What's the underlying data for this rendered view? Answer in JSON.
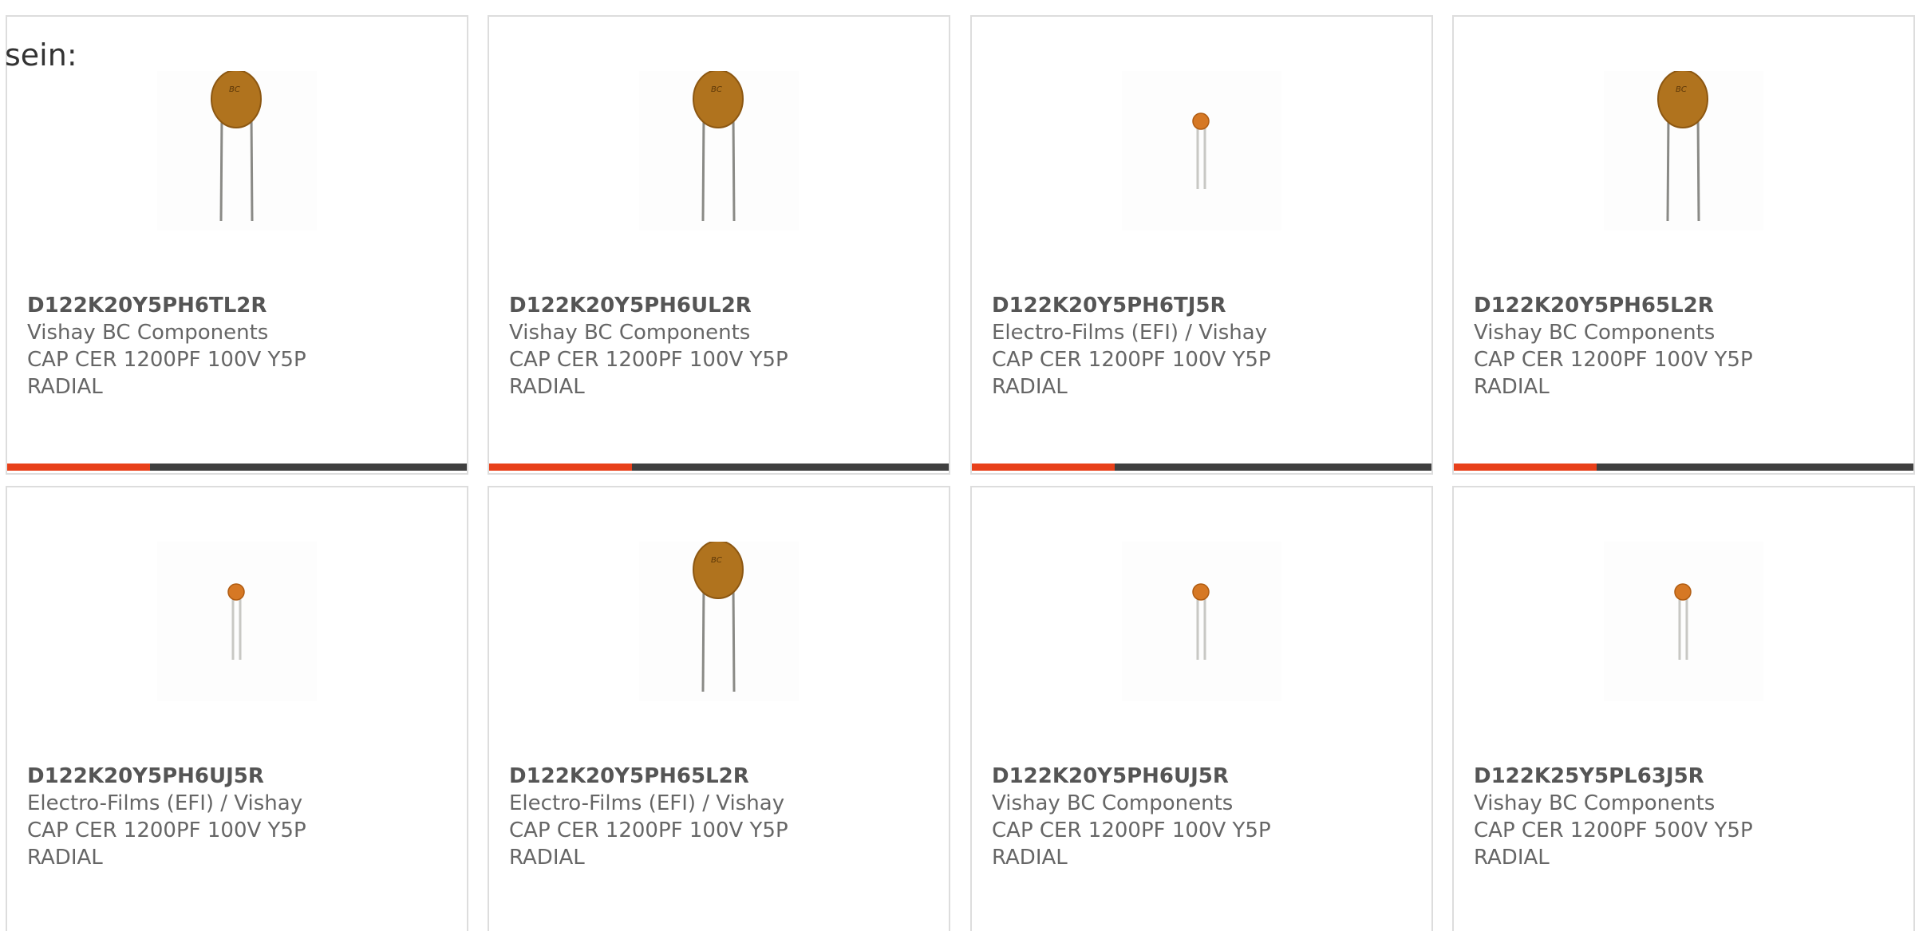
{
  "intro_text": "sein:",
  "colors": {
    "accent": "#e8401a",
    "track": "#3f3f3f",
    "body_large": "#b0731e",
    "body_small": "#d67824"
  },
  "products": [
    {
      "part": "D122K20Y5PH6TL2R",
      "maker": "Vishay BC Components",
      "desc": "CAP CER 1200PF 100V Y5P",
      "desc2": "RADIAL",
      "image": "large-disc-capacitor",
      "progress": 0.31
    },
    {
      "part": "D122K20Y5PH6UL2R",
      "maker": "Vishay BC Components",
      "desc": "CAP CER 1200PF 100V Y5P",
      "desc2": "RADIAL",
      "image": "large-disc-capacitor",
      "progress": 0.31
    },
    {
      "part": "D122K20Y5PH6TJ5R",
      "maker": "Electro-Films (EFI) / Vishay",
      "desc": "CAP CER 1200PF 100V Y5P",
      "desc2": "RADIAL",
      "image": "small-disc-capacitor",
      "progress": 0.31
    },
    {
      "part": "D122K20Y5PH65L2R",
      "maker": "Vishay BC Components",
      "desc": "CAP CER 1200PF 100V Y5P",
      "desc2": "RADIAL",
      "image": "large-disc-capacitor",
      "progress": 0.31
    },
    {
      "part": "D122K20Y5PH6UJ5R",
      "maker": "Electro-Films (EFI) / Vishay",
      "desc": "CAP CER 1200PF 100V Y5P",
      "desc2": "RADIAL",
      "image": "small-disc-capacitor"
    },
    {
      "part": "D122K20Y5PH65L2R",
      "maker": "Electro-Films (EFI) / Vishay",
      "desc": "CAP CER 1200PF 100V Y5P",
      "desc2": "RADIAL",
      "image": "large-disc-capacitor"
    },
    {
      "part": "D122K20Y5PH6UJ5R",
      "maker": "Vishay BC Components",
      "desc": "CAP CER 1200PF 100V Y5P",
      "desc2": "RADIAL",
      "image": "small-disc-capacitor"
    },
    {
      "part": "D122K25Y5PL63J5R",
      "maker": "Vishay BC Components",
      "desc": "CAP CER 1200PF 500V Y5P",
      "desc2": "RADIAL",
      "image": "small-disc-capacitor"
    }
  ]
}
